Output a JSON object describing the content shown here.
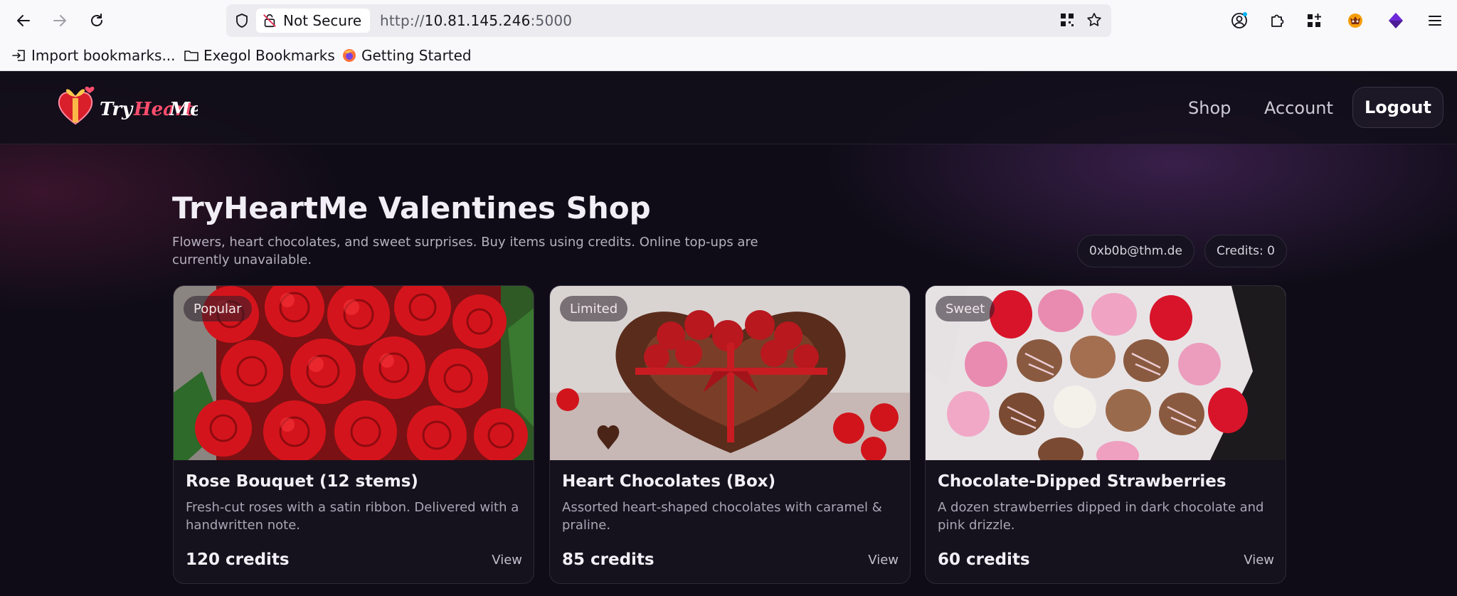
{
  "browser": {
    "url_host": "10.81.145.246",
    "url_port": ":5000",
    "url_scheme": "http://",
    "security_label": "Not Secure",
    "bookmarks": [
      {
        "label": "Import bookmarks..."
      },
      {
        "label": "Exegol Bookmarks"
      },
      {
        "label": "Getting Started"
      }
    ]
  },
  "header": {
    "logo_text": "TryHeartMe",
    "nav": {
      "shop": "Shop",
      "account": "Account",
      "logout": "Logout"
    }
  },
  "main": {
    "title": "TryHeartMe Valentines Shop",
    "subtitle": "Flowers, heart chocolates, and sweet surprises. Buy items using credits. Online top-ups are currently unavailable.",
    "user_email": "0xb0b@thm.de",
    "credits_label": "Credits: 0"
  },
  "products": [
    {
      "badge": "Popular",
      "name": "Rose Bouquet (12 stems)",
      "description": "Fresh-cut roses with a satin ribbon. Delivered with a handwritten note.",
      "price": "120 credits",
      "action": "View"
    },
    {
      "badge": "Limited",
      "name": "Heart Chocolates (Box)",
      "description": "Assorted heart-shaped chocolates with caramel & praline.",
      "price": "85 credits",
      "action": "View"
    },
    {
      "badge": "Sweet",
      "name": "Chocolate-Dipped Strawberries",
      "description": "A dozen strawberries dipped in dark chocolate and pink drizzle.",
      "price": "60 credits",
      "action": "View"
    }
  ],
  "colors": {
    "page_bg": "#0f0c17",
    "card_bg": "#15121d",
    "accent_rose": "#d81f2a"
  }
}
